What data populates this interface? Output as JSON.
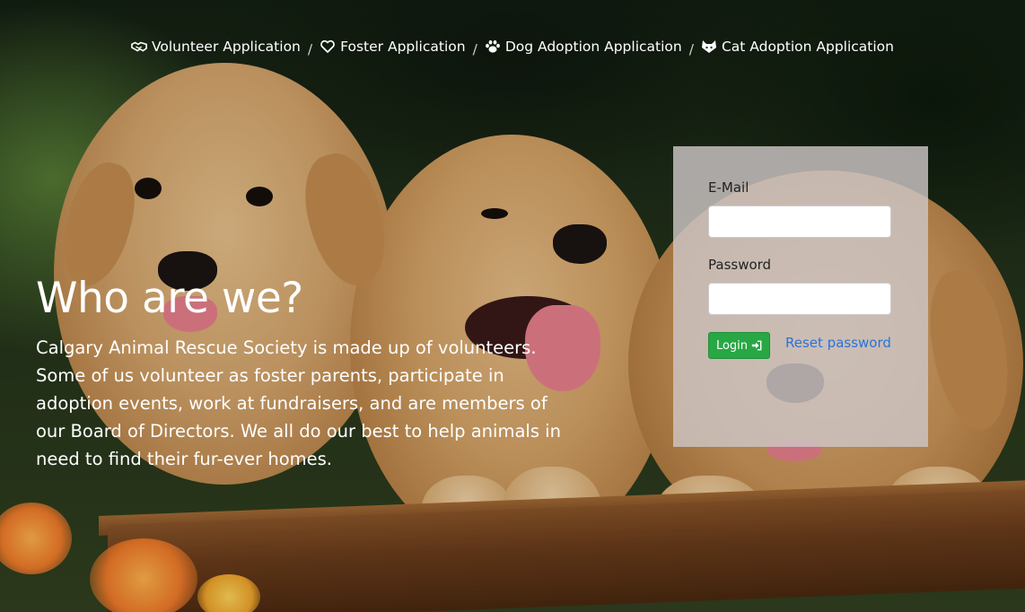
{
  "nav": {
    "items": [
      {
        "label": "Volunteer Application",
        "icon": "handshake-icon"
      },
      {
        "label": "Foster Application",
        "icon": "heart-icon"
      },
      {
        "label": "Dog Adoption Application",
        "icon": "paw-icon"
      },
      {
        "label": "Cat Adoption Application",
        "icon": "cat-icon"
      }
    ],
    "separator": "/"
  },
  "hero": {
    "title": "Who are we?",
    "body": "Calgary Animal Rescue Society is made up of volunteers. Some of us volunteer as foster parents, participate in adoption events, work at fundraisers, and are members of our Board of Directors. We all do our best to help animals in need to find their fur-ever homes."
  },
  "login": {
    "email_label": "E-Mail",
    "email_value": "",
    "password_label": "Password",
    "password_value": "",
    "login_button": "Login",
    "login_icon": "sign-in-icon",
    "reset_link": "Reset password"
  },
  "colors": {
    "login_button": "#28a745",
    "link": "#2a73d8",
    "panel": "#cdc6c6"
  }
}
